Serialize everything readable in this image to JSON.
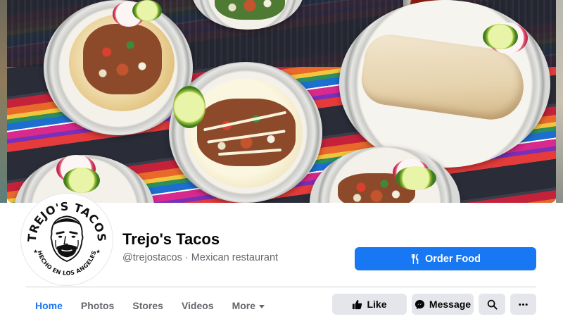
{
  "page": {
    "name": "Trejo's Tacos",
    "handle": "@trejostacos",
    "separator": " · ",
    "category": "Mexican restaurant"
  },
  "logo": {
    "text_top": "TREJO'S TACOS",
    "text_bottom": "HECHO EN LOS ANGELES"
  },
  "cta": {
    "order_label": "Order Food",
    "order_icon": "utensils-icon"
  },
  "tabs": [
    {
      "label": "Home",
      "active": true
    },
    {
      "label": "Photos",
      "active": false
    },
    {
      "label": "Stores",
      "active": false
    },
    {
      "label": "Videos",
      "active": false
    },
    {
      "label": "More",
      "active": false,
      "has_dropdown": true
    }
  ],
  "actions": {
    "like_label": "Like",
    "like_icon": "thumbs-up-icon",
    "message_label": "Message",
    "message_icon": "messenger-icon",
    "search_icon": "search-icon",
    "more_icon": "ellipsis-icon"
  },
  "colors": {
    "accent": "#1877f2",
    "secondary_button": "#e4e6eb",
    "muted_text": "#65676b"
  }
}
